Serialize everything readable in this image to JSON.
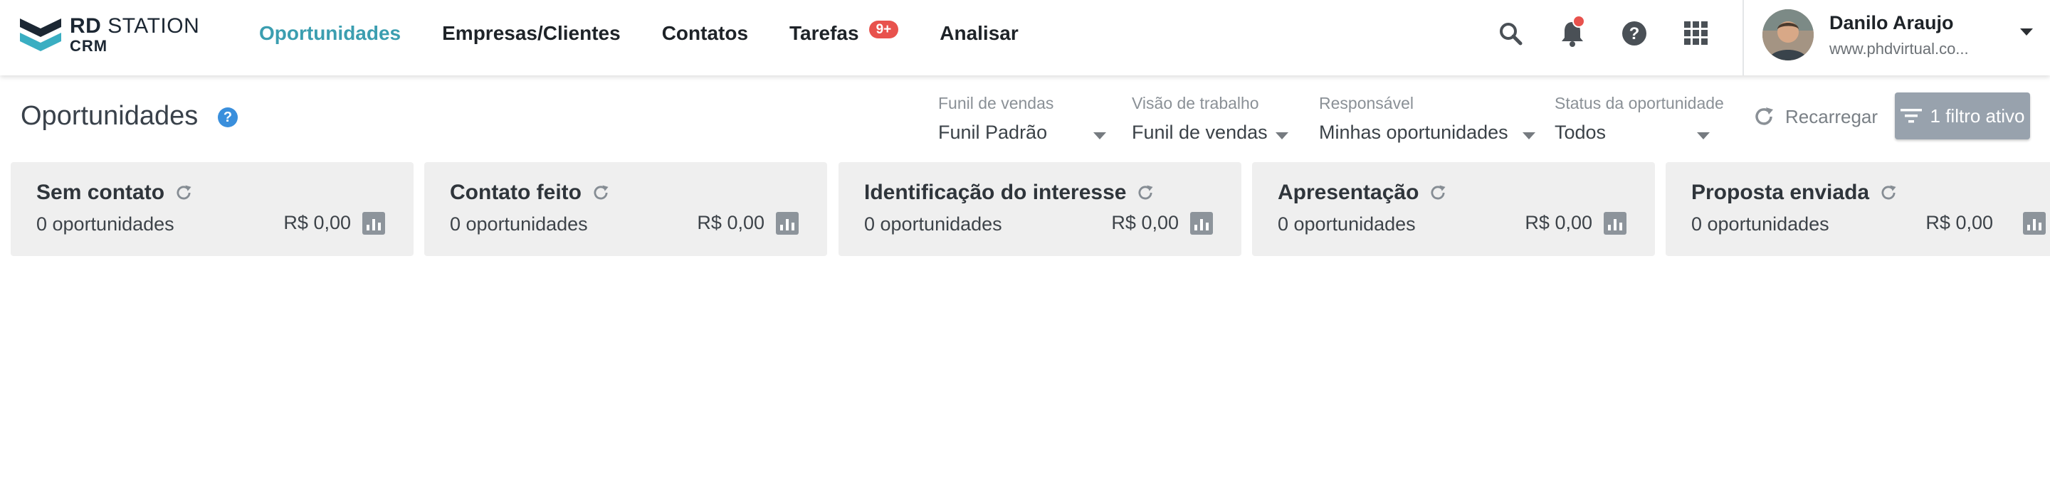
{
  "app": {
    "logo_top_bold": "RD",
    "logo_top_thin": "STATION",
    "logo_bottom": "CRM"
  },
  "nav": {
    "items": [
      {
        "label": "Oportunidades",
        "active": true
      },
      {
        "label": "Empresas/Clientes",
        "active": false
      },
      {
        "label": "Contatos",
        "active": false
      },
      {
        "label": "Tarefas",
        "active": false,
        "badge": "9+"
      },
      {
        "label": "Analisar",
        "active": false
      }
    ]
  },
  "toolbar_icons": [
    "search-icon",
    "bell-icon",
    "help-icon",
    "apps-grid-icon"
  ],
  "user": {
    "name": "Danilo Araujo",
    "site": "www.phdvirtual.co..."
  },
  "page": {
    "title": "Oportunidades",
    "help_glyph": "?"
  },
  "filters": [
    {
      "label": "Funil de vendas",
      "value": "Funil Padrão"
    },
    {
      "label": "Visão de trabalho",
      "value": "Funil de vendas"
    },
    {
      "label": "Responsável",
      "value": "Minhas oportunidades"
    },
    {
      "label": "Status da oportunidade",
      "value": "Todos"
    }
  ],
  "actions": {
    "reload_label": "Recarregar",
    "active_filter_label": "1 filtro ativo"
  },
  "stages": [
    {
      "title": "Sem contato",
      "count": "0 oportunidades",
      "value": "R$ 0,00"
    },
    {
      "title": "Contato feito",
      "count": "0 oportunidades",
      "value": "R$ 0,00"
    },
    {
      "title": "Identificação do interesse",
      "count": "0 oportunidades",
      "value": "R$ 0,00"
    },
    {
      "title": "Apresentação",
      "count": "0 oportunidades",
      "value": "R$ 0,00"
    },
    {
      "title": "Proposta enviada",
      "count": "0 oportunidades",
      "value": "R$ 0,00"
    }
  ],
  "colors": {
    "accent": "#3b9eb0",
    "badge": "#e8524d",
    "stage_bg": "#efefef",
    "filter_btn": "#98a2ad"
  }
}
